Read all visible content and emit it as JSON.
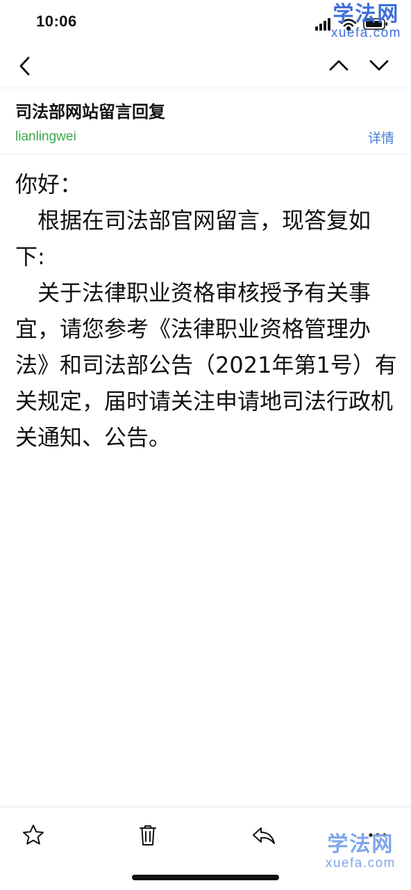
{
  "status_bar": {
    "time": "10:06"
  },
  "watermark_top": {
    "text_cn": "学法网",
    "text_en": "xuefa.com"
  },
  "watermark_bottom": {
    "text_cn": "学法网",
    "text_en": "xuefa.com"
  },
  "nav": {
    "back_icon": "chevron-left-icon",
    "prev_icon": "chevron-up-icon",
    "next_icon": "chevron-down-icon"
  },
  "email": {
    "subject": "司法部网站留言回复",
    "sender": "lianlingwei",
    "details_label": "详情",
    "body": {
      "greeting": "你好：",
      "paragraph1": "根据在司法部官网留言，现答复如下:",
      "paragraph2": "关于法律职业资格审核授予有关事宜，请您参考《法律职业资格管理办法》和司法部公告（2021年第1号）有关规定，届时请关注申请地司法行政机关通知、公告。"
    }
  },
  "toolbar": {
    "items": [
      "star-icon",
      "trash-icon",
      "reply-icon",
      "more-icon"
    ]
  },
  "colors": {
    "sender_green": "#3aa84a",
    "link_blue": "#3e7fd6",
    "watermark_blue": "#3f6fd8"
  }
}
